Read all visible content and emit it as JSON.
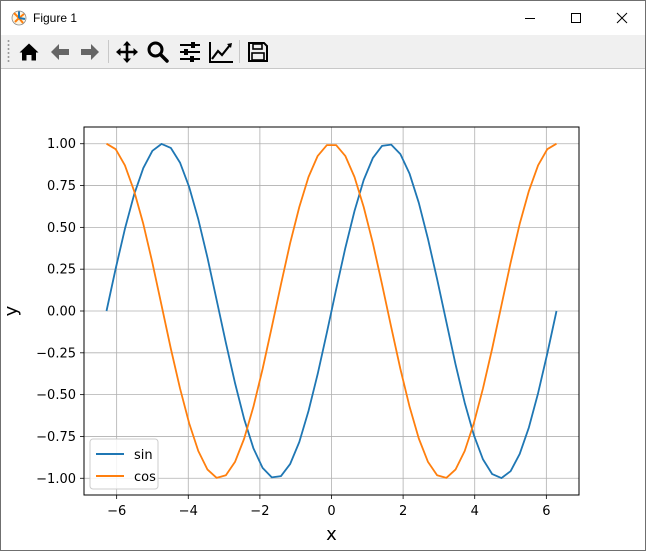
{
  "window": {
    "title": "Figure 1",
    "icons": {
      "app": "matplotlib-icon",
      "minimize": "minimize-icon",
      "maximize": "maximize-icon",
      "close": "close-icon"
    }
  },
  "toolbar": {
    "buttons": [
      {
        "name": "home",
        "icon": "home-icon"
      },
      {
        "name": "back",
        "icon": "arrow-left-icon"
      },
      {
        "name": "forward",
        "icon": "arrow-right-icon"
      },
      {
        "name": "pan",
        "icon": "move-icon"
      },
      {
        "name": "zoom",
        "icon": "magnifier-icon"
      },
      {
        "name": "subplots",
        "icon": "sliders-icon"
      },
      {
        "name": "edit-axis",
        "icon": "line-chart-icon"
      },
      {
        "name": "save",
        "icon": "floppy-disk-icon"
      }
    ]
  },
  "chart_data": {
    "type": "line",
    "title": "",
    "xlabel": "x",
    "ylabel": "y",
    "xlim": [
      -6.912,
      6.912
    ],
    "ylim": [
      -1.1,
      1.1
    ],
    "xticks": [
      -6,
      -4,
      -2,
      0,
      2,
      4,
      6
    ],
    "xtick_labels": [
      "−6",
      "−4",
      "−2",
      "0",
      "2",
      "4",
      "6"
    ],
    "yticks": [
      1.0,
      0.75,
      0.5,
      0.25,
      0.0,
      -0.25,
      -0.5,
      -0.75,
      -1.0
    ],
    "ytick_labels": [
      "1.00",
      "0.75",
      "0.50",
      "0.25",
      "0.00",
      "−0.25",
      "−0.50",
      "−0.75",
      "−1.00"
    ],
    "grid": true,
    "legend_position": "lower-left",
    "x": [
      -6.283,
      -6.027,
      -5.77,
      -5.514,
      -5.257,
      -5.001,
      -4.745,
      -4.488,
      -4.232,
      -3.975,
      -3.719,
      -3.463,
      -3.206,
      -2.95,
      -2.693,
      -2.437,
      -2.181,
      -1.924,
      -1.668,
      -1.411,
      -1.155,
      -0.898,
      -0.642,
      -0.386,
      -0.129,
      0.129,
      0.386,
      0.642,
      0.898,
      1.155,
      1.411,
      1.668,
      1.924,
      2.181,
      2.437,
      2.693,
      2.95,
      3.206,
      3.463,
      3.719,
      3.975,
      4.232,
      4.488,
      4.745,
      5.001,
      5.257,
      5.514,
      5.77,
      6.027,
      6.283
    ],
    "series": [
      {
        "name": "sin",
        "color": "#1f77b4",
        "values": [
          0.0,
          0.254,
          0.491,
          0.696,
          0.854,
          0.958,
          0.999,
          0.975,
          0.887,
          0.741,
          0.548,
          0.318,
          0.064,
          -0.191,
          -0.433,
          -0.647,
          -0.82,
          -0.938,
          -0.995,
          -0.987,
          -0.915,
          -0.783,
          -0.598,
          -0.376,
          -0.128,
          0.128,
          0.376,
          0.598,
          0.783,
          0.915,
          0.987,
          0.995,
          0.938,
          0.82,
          0.647,
          0.433,
          0.191,
          -0.064,
          -0.318,
          -0.548,
          -0.741,
          -0.887,
          -0.975,
          -0.999,
          -0.958,
          -0.854,
          -0.696,
          -0.491,
          -0.254,
          0.0
        ]
      },
      {
        "name": "cos",
        "color": "#ff7f0e",
        "values": [
          1.0,
          0.967,
          0.871,
          0.718,
          0.521,
          0.288,
          0.032,
          -0.224,
          -0.462,
          -0.672,
          -0.837,
          -0.948,
          -0.998,
          -0.982,
          -0.901,
          -0.762,
          -0.573,
          -0.347,
          -0.096,
          0.16,
          0.405,
          0.622,
          0.801,
          0.927,
          0.992,
          0.992,
          0.927,
          0.801,
          0.622,
          0.405,
          0.16,
          -0.096,
          -0.347,
          -0.573,
          -0.762,
          -0.901,
          -0.982,
          -0.998,
          -0.948,
          -0.837,
          -0.672,
          -0.462,
          -0.224,
          0.032,
          0.288,
          0.521,
          0.718,
          0.871,
          0.967,
          1.0
        ]
      }
    ]
  }
}
